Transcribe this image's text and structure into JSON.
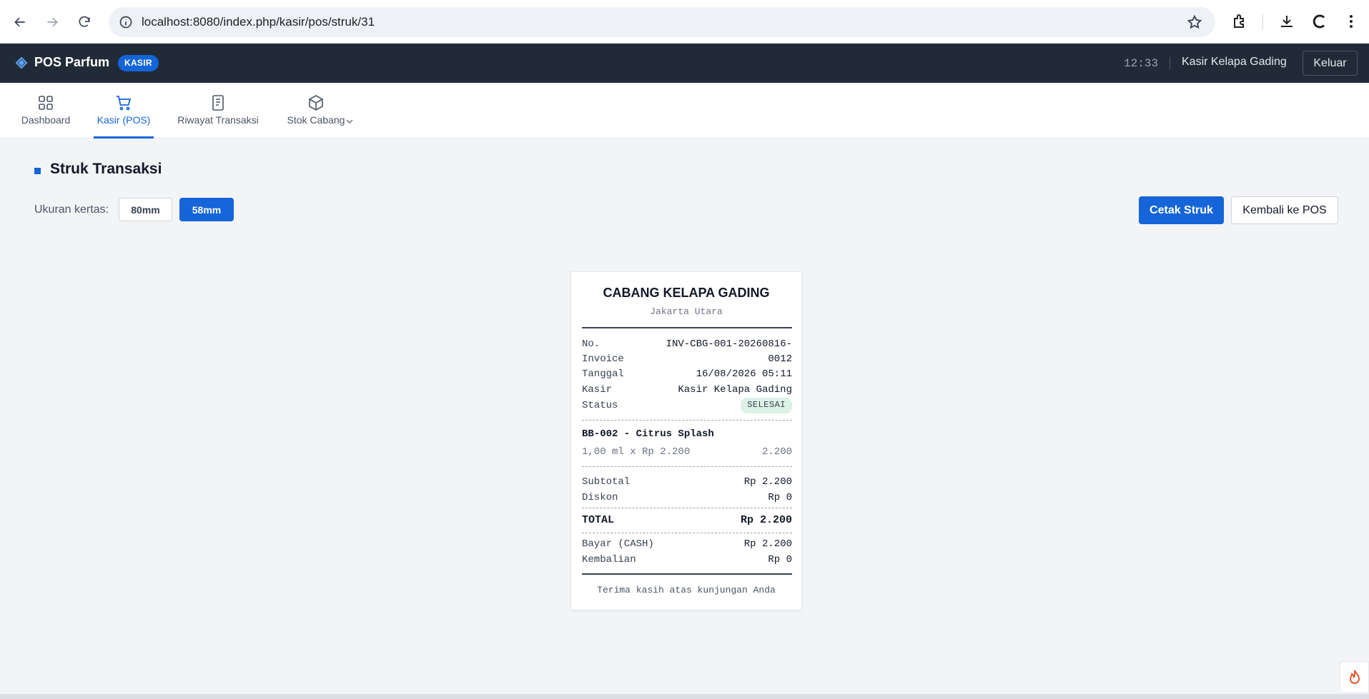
{
  "browser": {
    "url": "localhost:8080/index.php/kasir/pos/struk/31"
  },
  "header": {
    "brand": "POS Parfum",
    "role_badge": "KASIR",
    "clock": "12:33",
    "user": "Kasir Kelapa Gading",
    "logout_label": "Keluar"
  },
  "tabs": [
    {
      "label": "Dashboard",
      "icon": "grid-icon"
    },
    {
      "label": "Kasir (POS)",
      "icon": "cart-icon",
      "active": true
    },
    {
      "label": "Riwayat Transaksi",
      "icon": "document-icon"
    },
    {
      "label": "Stok Cabang",
      "icon": "box-icon",
      "has_dropdown": true
    }
  ],
  "page": {
    "title": "Struk Transaksi",
    "paper_label": "Ukuran kertas:",
    "paper_options": [
      "80mm",
      "58mm"
    ],
    "paper_selected": "58mm",
    "print_label": "Cetak Struk",
    "back_label": "Kembali ke POS"
  },
  "receipt": {
    "store": "CABANG KELAPA GADING",
    "city": "Jakarta Utara",
    "invoice_label_1": "No.",
    "invoice_label_2": "Invoice",
    "invoice_value_1": "INV-CBG-001-20260816-",
    "invoice_value_2": "0012",
    "date_label": "Tanggal",
    "date_value": "16/08/2026 05:11",
    "cashier_label": "Kasir",
    "cashier_value": "Kasir Kelapa Gading",
    "status_label": "Status",
    "status_value": "SELESAI",
    "items": [
      {
        "name": "BB-002 - Citrus Splash",
        "qty_line": "1,00 ml x Rp 2.200",
        "amount": "2.200"
      }
    ],
    "subtotal_label": "Subtotal",
    "subtotal_value": "Rp 2.200",
    "discount_label": "Diskon",
    "discount_value": "Rp 0",
    "total_label": "TOTAL",
    "total_value": "Rp 2.200",
    "paid_label": "Bayar (CASH)",
    "paid_value": "Rp 2.200",
    "change_label": "Kembalian",
    "change_value": "Rp 0",
    "footer": "Terima kasih atas kunjungan Anda"
  },
  "colors": {
    "accent": "#1565d8",
    "header_bg": "#212b38",
    "status_bg": "#dcf2e6"
  }
}
